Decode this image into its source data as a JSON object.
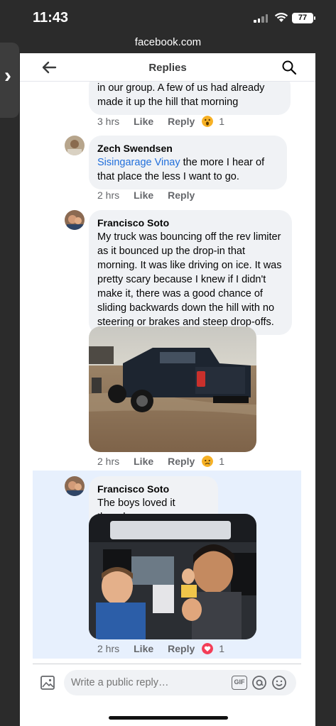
{
  "status_bar": {
    "time": "11:43",
    "battery": "77"
  },
  "browser": {
    "url": "facebook.com"
  },
  "header": {
    "title": "Replies"
  },
  "comments": [
    {
      "text_fragment": "in our group. A few of us had already made it up the hill that morning",
      "time": "3 hrs",
      "like": "Like",
      "reply": "Reply",
      "reaction": "wow",
      "reaction_count": "1"
    },
    {
      "author": "Zech Swendsen",
      "mention": "Sisingarage Vinay",
      "text": " the more I hear of that place the less I want to go.",
      "time": "2 hrs",
      "like": "Like",
      "reply": "Reply"
    },
    {
      "author": "Francisco Soto",
      "text": "My truck was bouncing off the rev limiter as it bounced up the drop-in that morning. It was like driving on ice. It was pretty scary because I knew if I didn't make it, there was a good chance of sliding backwards down the hill with no steering or brakes and steep drop-offs.",
      "time": "2 hrs",
      "like": "Like",
      "reply": "Reply",
      "reaction": "sad",
      "reaction_count": "1"
    },
    {
      "author": "Francisco Soto",
      "text": "The boys loved it though:",
      "time": "2 hrs",
      "like": "Like",
      "reply": "Reply",
      "reaction": "love",
      "reaction_count": "1"
    }
  ],
  "composer": {
    "placeholder": "Write a public reply…",
    "gif_label": "GIF"
  },
  "colors": {
    "mention": "#216fdb",
    "highlight": "#e7f0fd",
    "love": "#f33e58",
    "haha": "#f7b125"
  }
}
